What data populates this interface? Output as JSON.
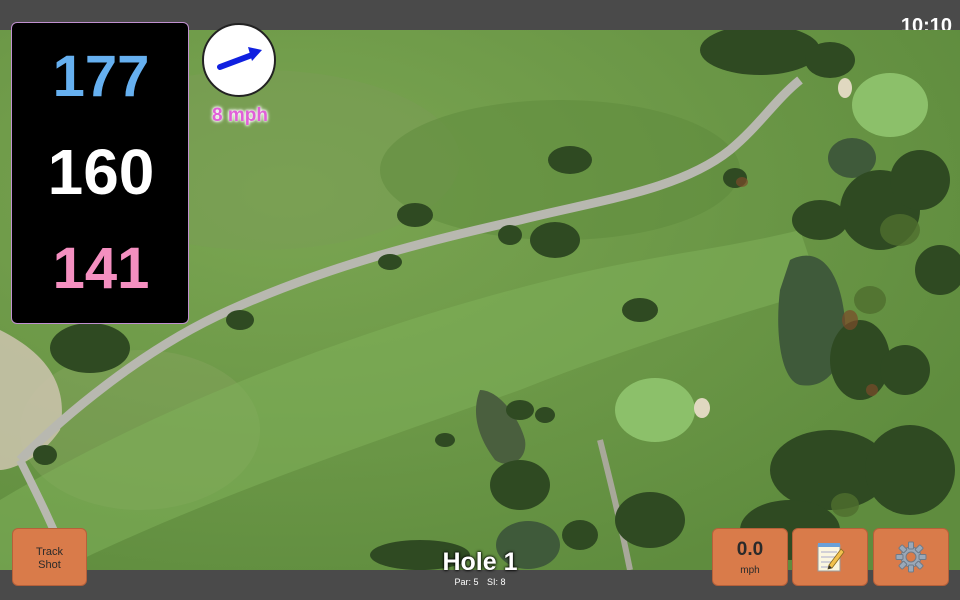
{
  "status_bar": {
    "time": "10:10"
  },
  "yardage": {
    "back": "177",
    "center": "160",
    "front": "141"
  },
  "wind": {
    "speed": "8 mph",
    "icon": "wind-arrow-icon"
  },
  "hole": {
    "title": "Hole 1",
    "par": "Par: 5",
    "si": "SI: 8"
  },
  "buttons": {
    "track_shot_line1": "Track",
    "track_shot_line2": "Shot",
    "speed_value": "0.0",
    "speed_unit": "mph",
    "notes_icon": "notepad-icon",
    "settings_icon": "gear-icon"
  },
  "colors": {
    "back_yardage": "#66b0f0",
    "center_yardage": "#ffffff",
    "front_yardage": "#f48fc0",
    "button_orange": "#d97b4a",
    "wind_text": "#e060d8"
  }
}
